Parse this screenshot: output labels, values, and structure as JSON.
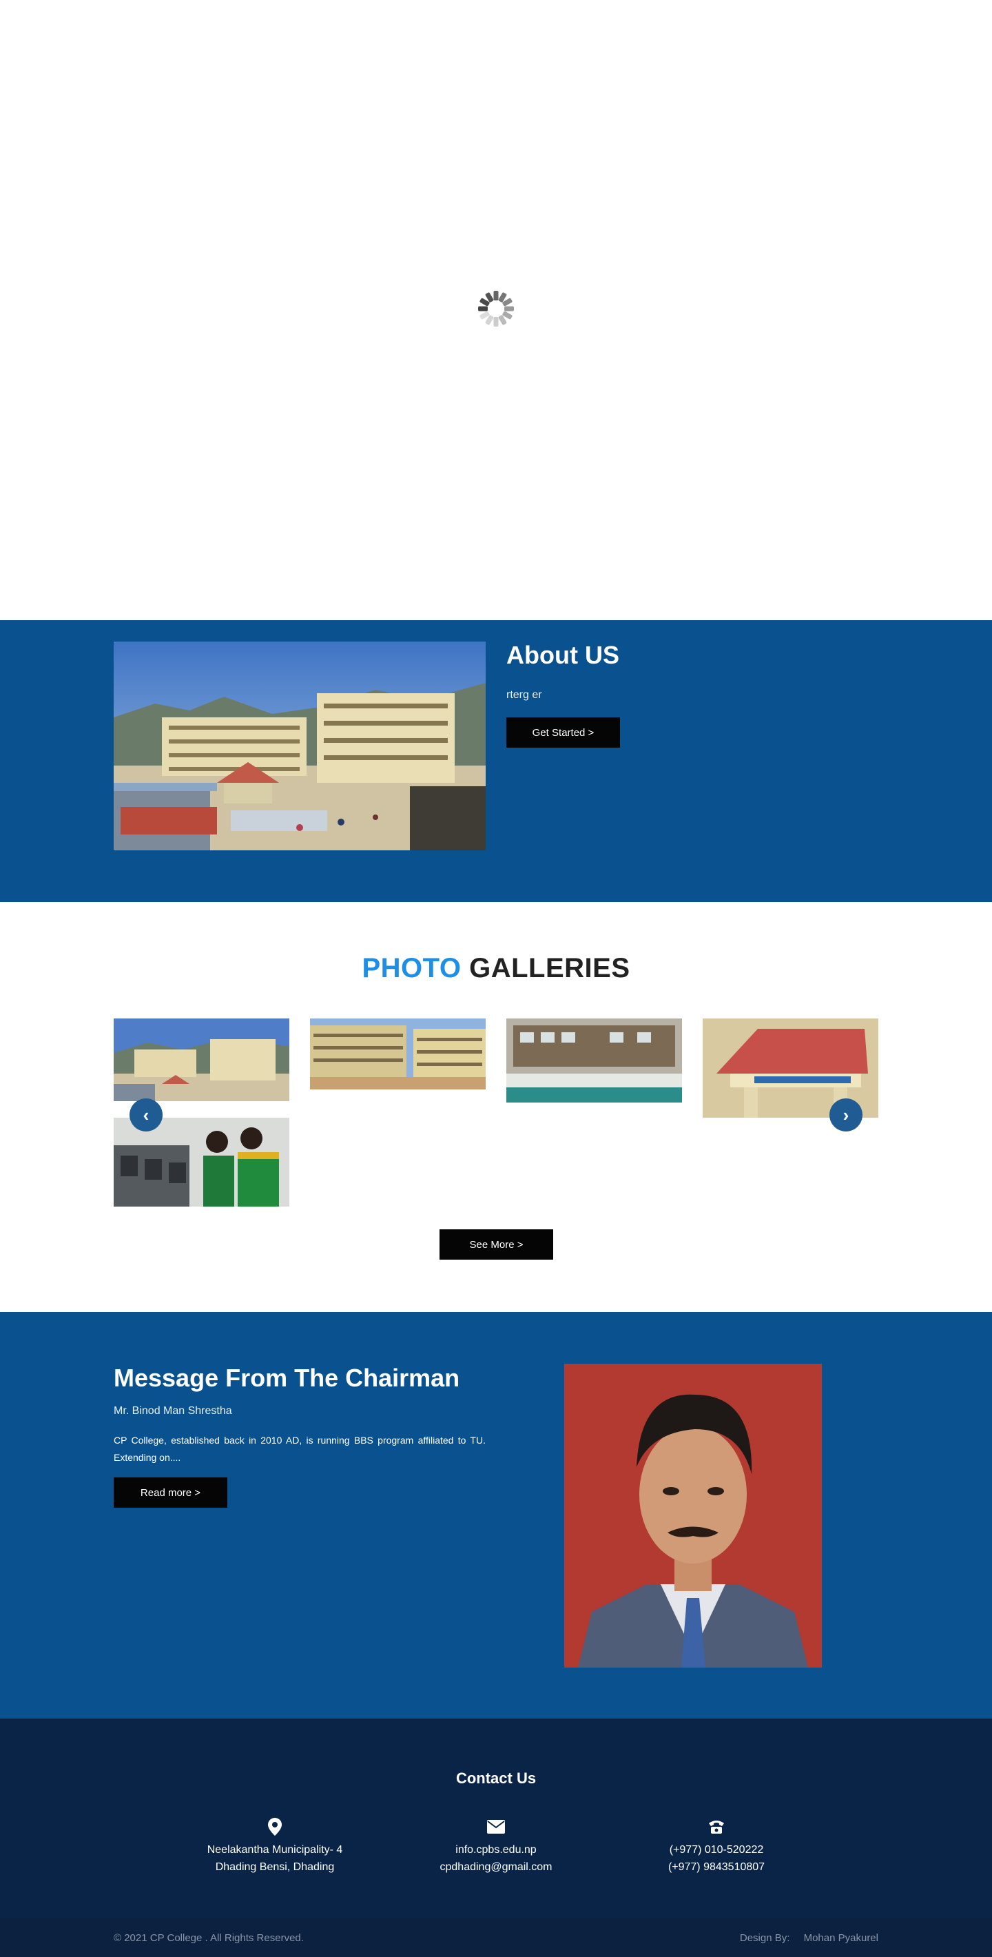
{
  "about": {
    "title": "About US",
    "text": "rterg er",
    "button_label": "Get Started >"
  },
  "gallery": {
    "title_highlight": "PHOTO",
    "title_rest": "GALLERIES",
    "prev_symbol": "‹",
    "next_symbol": "›",
    "button_label": "See More >"
  },
  "chairman": {
    "title": "Message From The Chairman",
    "name": "Mr. Binod Man Shrestha",
    "text": "CP College, established back in 2010 AD, is running BBS program affiliated to TU. Extending on....",
    "button_label": "Read more >"
  },
  "contact": {
    "title": "Contact Us",
    "address_line1": "Neelakantha Municipality- 4",
    "address_line2": "Dhading Bensi, Dhading",
    "email_line1": "info.cpbs.edu.np",
    "email_line2": "cpdhading@gmail.com",
    "phone_line1": "(+977) 010-520222",
    "phone_line2": "(+977) 9843510807",
    "icons": [
      "location-pin-icon",
      "envelope-icon",
      "phone-icon"
    ]
  },
  "footer": {
    "copyright": "© 2021 CP College . All Rights Reserved.",
    "design_label": "Design By:",
    "designer": "Mohan Pyakurel"
  },
  "colors": {
    "primary_blue": "#0a528f",
    "contact_navy": "#0a2447",
    "accent_blue": "#1e8fe6",
    "button_black": "#050505"
  }
}
